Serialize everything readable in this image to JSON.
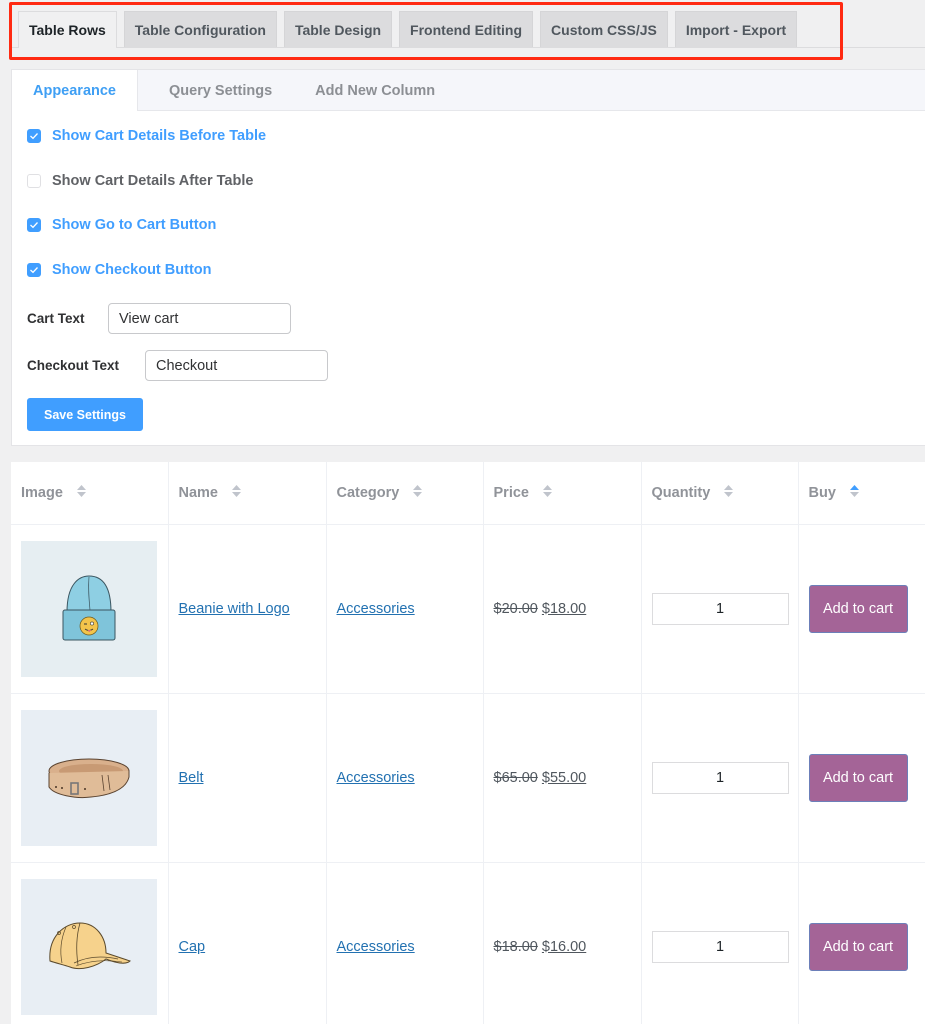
{
  "top_tabs": [
    {
      "label": "Table Rows",
      "active": true
    },
    {
      "label": "Table Configuration",
      "active": false
    },
    {
      "label": "Table Design",
      "active": false
    },
    {
      "label": "Frontend Editing",
      "active": false
    },
    {
      "label": "Custom CSS/JS",
      "active": false
    },
    {
      "label": "Import - Export",
      "active": false
    }
  ],
  "sub_tabs": [
    {
      "label": "Appearance",
      "active": true
    },
    {
      "label": "Query Settings",
      "active": false
    },
    {
      "label": "Add New Column",
      "active": false
    }
  ],
  "options": [
    {
      "label": "Show Cart Details Before Table",
      "checked": true
    },
    {
      "label": "Show Cart Details After Table",
      "checked": false
    },
    {
      "label": "Show Go to Cart Button",
      "checked": true
    },
    {
      "label": "Show Checkout Button",
      "checked": true
    }
  ],
  "fields": {
    "cart_text": {
      "label": "Cart Text",
      "value": "View cart"
    },
    "checkout_text": {
      "label": "Checkout Text",
      "value": "Checkout"
    }
  },
  "save_label": "Save Settings",
  "table": {
    "columns": [
      {
        "label": "Image",
        "sort": "none"
      },
      {
        "label": "Name",
        "sort": "none"
      },
      {
        "label": "Category",
        "sort": "none"
      },
      {
        "label": "Price",
        "sort": "none"
      },
      {
        "label": "Quantity",
        "sort": "none"
      },
      {
        "label": "Buy",
        "sort": "asc"
      }
    ],
    "rows": [
      {
        "image": "beanie-image",
        "name": "Beanie with Logo",
        "category": "Accessories",
        "price_old": "$20.00",
        "price_new": "$18.00",
        "quantity": "1",
        "buy_label": "Add to cart"
      },
      {
        "image": "belt-image",
        "name": "Belt",
        "category": "Accessories",
        "price_old": "$65.00",
        "price_new": "$55.00",
        "quantity": "1",
        "buy_label": "Add to cart"
      },
      {
        "image": "cap-image",
        "name": "Cap",
        "category": "Accessories",
        "price_old": "$18.00",
        "price_new": "$16.00",
        "quantity": "1",
        "buy_label": "Add to cart"
      }
    ]
  },
  "colors": {
    "accent": "#409eff",
    "highlight": "#ff2a12",
    "add_to_cart": "#a46497",
    "link": "#2271b1"
  }
}
